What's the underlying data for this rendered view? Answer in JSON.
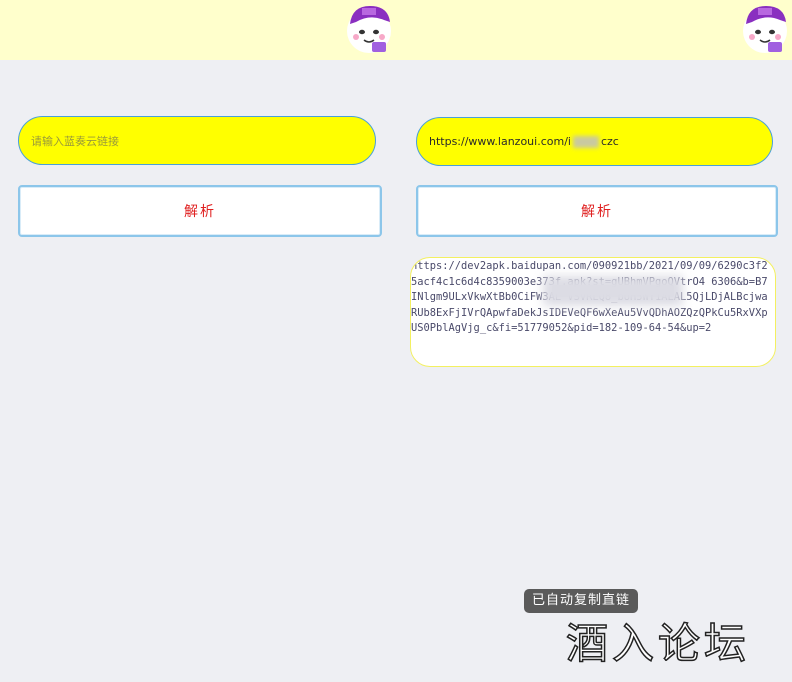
{
  "left": {
    "link_input": {
      "placeholder": "请输入蓝奏云链接",
      "value": ""
    },
    "parse_button_label": "解析"
  },
  "right": {
    "link_input": {
      "value_prefix": "https://www.lanzoui.com/i",
      "value_suffix": "czc"
    },
    "parse_button_label": "解析",
    "result_text": "https://dev2apk.baidupan.com/090921bb/2021/09/09/6290c3f25acf4c1c6d4c8359003e373f.apk?st=gUBhmVPgoQVtrO4            6306&b=B7INlgm9ULxVkwXtBb0CiFW3AL                VSVRLQ8_bUH5WY1ALAL5QjLDjALBcjwaRUb8ExFjIVrQApwfaDekJsIDEVeQF6wXeAu5VvQDhAOZQzQPkCu5RxVXpUS0PblAgVjg_c&fi=51779052&pid=182-109-64-54&up=2"
  },
  "toast": "已自动复制直链",
  "watermark": "酒入论坛",
  "colors": {
    "topbar": "#ffffcc",
    "input_bg": "#ffff00",
    "input_border": "#4aa0d8",
    "button_text": "#e02020",
    "background": "#eeeff3"
  }
}
